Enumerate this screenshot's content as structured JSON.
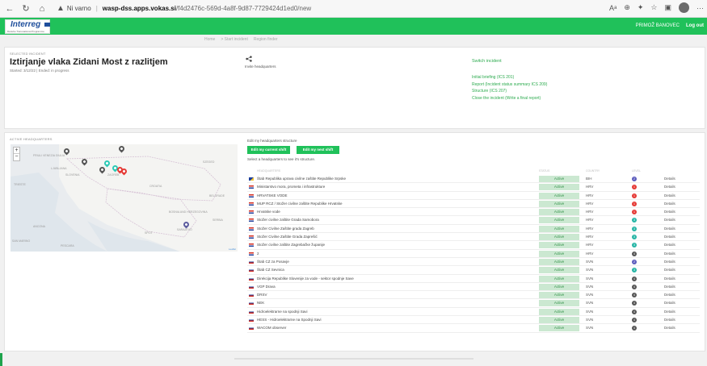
{
  "browser": {
    "security_label": "Ni varno",
    "separator": "|",
    "url_host": "wasp-dss.apps.vokas.si",
    "url_path": "/f4d2476c-569d-4a8f-9d87-7729424d1ed0/new",
    "icons": [
      "back-icon",
      "refresh-icon",
      "home-icon",
      "warning-icon",
      "read-aloud-icon",
      "zoom-icon",
      "extensions-icon",
      "favorites-icon",
      "collections-icon",
      "profile-icon",
      "more-icon"
    ]
  },
  "app": {
    "logo_text": "Interreg",
    "logo_sub": "Danube Transnational Programme",
    "user": "PRIMOŽ BANOVEC",
    "logout": "Log out"
  },
  "breadcrumb": [
    "Home",
    "> Start incident",
    "Region finder"
  ],
  "incident": {
    "section_label": "Selected incident",
    "title": "Iztirjanje vlaka Zidani Most z razlitjem",
    "meta": "Started: 3/12/22 | Ended: in progress",
    "invite": "Invite headquarters",
    "switch": "Switch incident",
    "links": [
      "Initial briefing (ICS 201)",
      "Report (Incident status summary ICS 209)",
      "Structure (ICS 207)",
      "Close the incident (Write a final report)"
    ]
  },
  "active_hq": {
    "section_label": "Active headquarters",
    "map": {
      "labels": [
        "Friuli Venezia Giulia",
        "Ljubljana",
        "Slovenia",
        "Trieste",
        "Croatia",
        "Zagreb",
        "Bosnia and Herzegovina",
        "Sarajevo",
        "Split",
        "Belgrade",
        "Ancona",
        "Pescara",
        "San Marino",
        "Serbia",
        "Szeged"
      ],
      "attribution": "Leaflet",
      "zoom_in": "+",
      "zoom_out": "−",
      "pin_colors": [
        "#555555",
        "#2cc9b5",
        "#e53935",
        "#5c5c9e"
      ]
    },
    "edit_text": "Edit my headquarters structure",
    "btn_current": "Edit my current shift",
    "btn_next": "Edit my next shift",
    "select_text": "Select a headquarters to see it's structure.",
    "columns": {
      "name": "Headquarters",
      "status": "Status",
      "country": "Country",
      "level": "Level"
    },
    "rows": [
      {
        "name": "Štab Republika uprava civilne zaštite Republike Srpske",
        "status": "Active",
        "country": "BIH",
        "level": "2",
        "levelColor": "#5c5cbd",
        "flag": "bih",
        "details": "Details"
      },
      {
        "name": "Ministarstvo mora, prometa i infrastrukture",
        "status": "Active",
        "country": "HRV",
        "level": "1",
        "levelColor": "#e53935",
        "flag": "hrv",
        "details": "Details"
      },
      {
        "name": "HRVATSKE VODE",
        "status": "Active",
        "country": "HRV",
        "level": "1",
        "levelColor": "#e53935",
        "flag": "hrv",
        "details": "Details"
      },
      {
        "name": "MUP RCZ / Stožer civilne zaštite Republike Hrvatske",
        "status": "Active",
        "country": "HRV",
        "level": "1",
        "levelColor": "#e53935",
        "flag": "hrv",
        "details": "Details"
      },
      {
        "name": "Hrvatske vode",
        "status": "Active",
        "country": "HRV",
        "level": "1",
        "levelColor": "#e53935",
        "flag": "hrv",
        "details": "Details"
      },
      {
        "name": "Stožer civilne zaštite Grada Samobora",
        "status": "Active",
        "country": "HRV",
        "level": "3",
        "levelColor": "#26b5a5",
        "flag": "hrv",
        "details": "Details"
      },
      {
        "name": "Stožer Civilne Zaštite grada Zagreb",
        "status": "Active",
        "country": "HRV",
        "level": "3",
        "levelColor": "#26b5a5",
        "flag": "hrv",
        "details": "Details"
      },
      {
        "name": "Stožer Civilne Zaštite Grada Zaprešić",
        "status": "Active",
        "country": "HRV",
        "level": "3",
        "levelColor": "#26b5a5",
        "flag": "hrv",
        "details": "Details"
      },
      {
        "name": "Stožer civilne zaštite Zagrebačke županije",
        "status": "Active",
        "country": "HRV",
        "level": "3",
        "levelColor": "#26b5a5",
        "flag": "hrv",
        "details": "Details"
      },
      {
        "name": "2",
        "status": "Active",
        "country": "HRV",
        "level": "4",
        "levelColor": "#555555",
        "flag": "hrv",
        "details": "Details"
      },
      {
        "name": "Štab CZ za Posavje",
        "status": "Active",
        "country": "SVN",
        "level": "2",
        "levelColor": "#5c5cbd",
        "flag": "svn",
        "details": "Details"
      },
      {
        "name": "Štab CZ Sevnica",
        "status": "Active",
        "country": "SVN",
        "level": "3",
        "levelColor": "#26b5a5",
        "flag": "svn",
        "details": "Details"
      },
      {
        "name": "Direkcija Republike Slovenije za vode - sektor spodnje Save",
        "status": "Active",
        "country": "SVN",
        "level": "4",
        "levelColor": "#555555",
        "flag": "svn",
        "details": "Details"
      },
      {
        "name": "VGP Drava",
        "status": "Active",
        "country": "SVN",
        "level": "4",
        "levelColor": "#555555",
        "flag": "svn",
        "details": "Details"
      },
      {
        "name": "DRSV",
        "status": "Active",
        "country": "SVN",
        "level": "4",
        "levelColor": "#555555",
        "flag": "svn",
        "details": "Details"
      },
      {
        "name": "NEK",
        "status": "Active",
        "country": "SVN",
        "level": "4",
        "levelColor": "#555555",
        "flag": "svn",
        "details": "Details"
      },
      {
        "name": "Hidroelektrarne na spodnji Savi",
        "status": "Active",
        "country": "SVN",
        "level": "4",
        "levelColor": "#555555",
        "flag": "svn",
        "details": "Details"
      },
      {
        "name": "HESS - Hidroelektrarne na Spodnji Savi",
        "status": "Active",
        "country": "SVN",
        "level": "4",
        "levelColor": "#555555",
        "flag": "svn",
        "details": "Details"
      },
      {
        "name": "WACOM observer",
        "status": "Active",
        "country": "SVN",
        "level": "4",
        "levelColor": "#555555",
        "flag": "svn",
        "details": "Details"
      }
    ]
  }
}
